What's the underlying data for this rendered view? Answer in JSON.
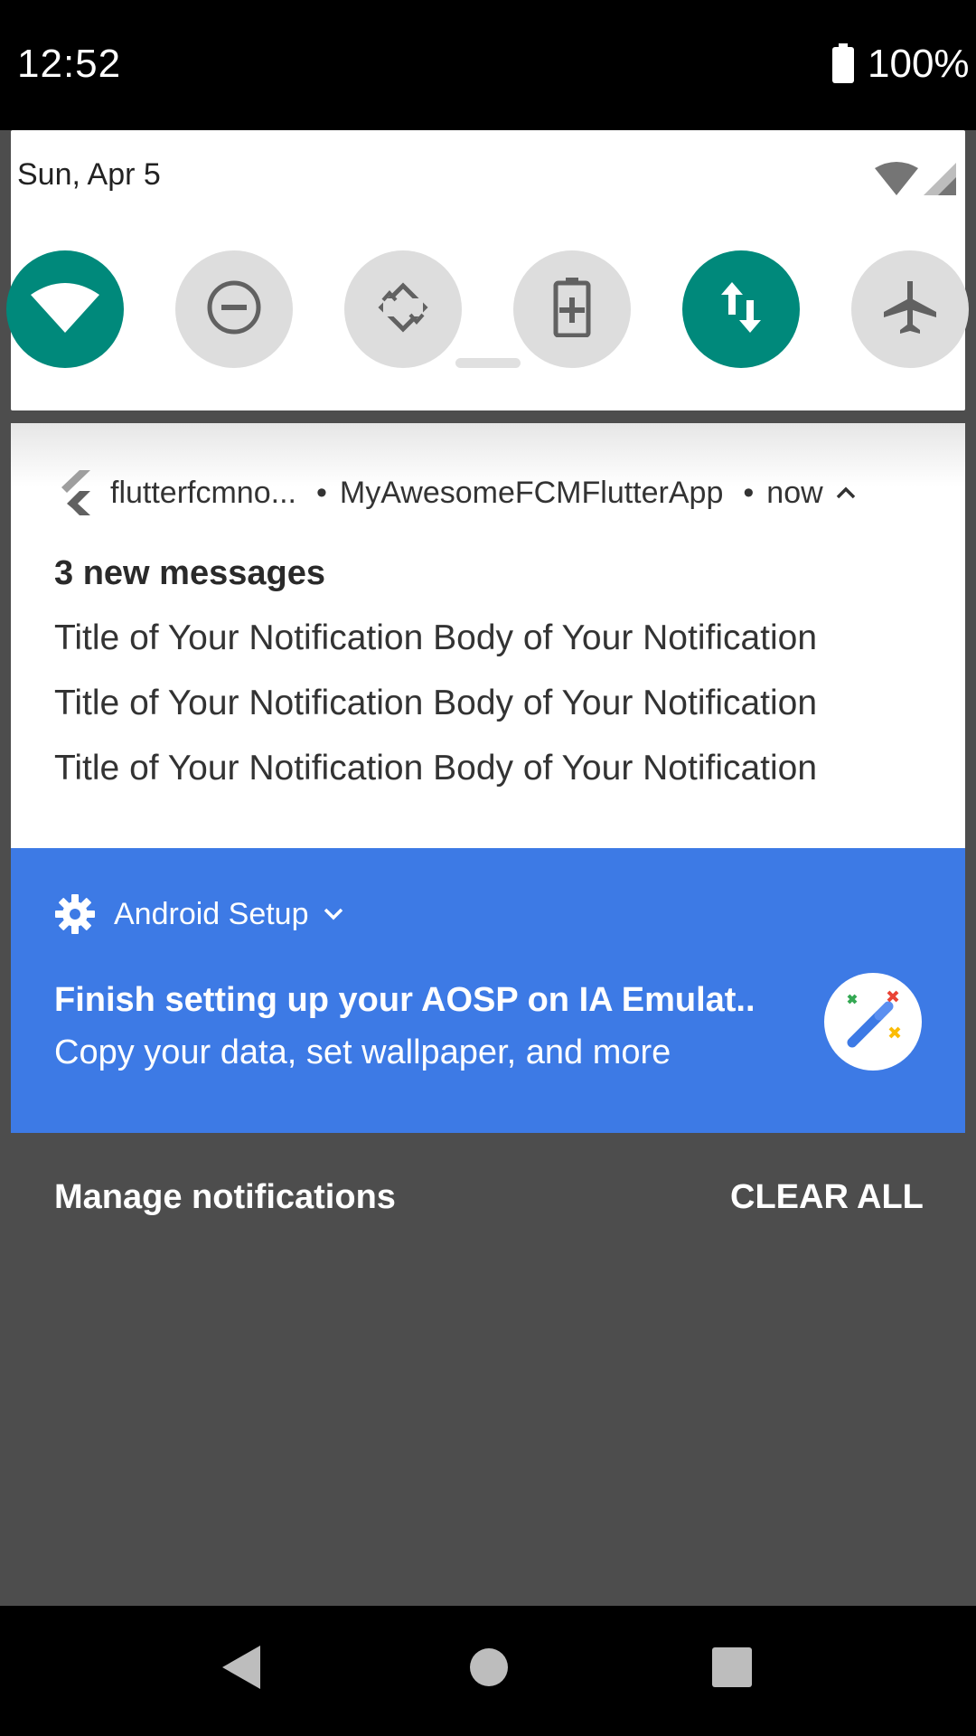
{
  "status_bar": {
    "time": "12:52",
    "battery": "100%"
  },
  "quick_settings": {
    "date": "Sun, Apr 5",
    "accent_color": "#00897b",
    "tiles": [
      {
        "icon": "wifi-icon",
        "state": "on"
      },
      {
        "icon": "do-not-disturb-icon",
        "state": "off"
      },
      {
        "icon": "auto-rotate-icon",
        "state": "off"
      },
      {
        "icon": "battery-saver-icon",
        "state": "off"
      },
      {
        "icon": "mobile-data-icon",
        "state": "on"
      },
      {
        "icon": "airplane-mode-icon",
        "state": "off"
      }
    ]
  },
  "notification": {
    "app_name": "flutterfcmno...",
    "channel": "MyAwesomeFCMFlutterApp",
    "time": "now",
    "title": "3 new messages",
    "lines": [
      "Title of Your Notification Body of Your Notification",
      "Title of Your Notification Body of Your Notification",
      "Title of Your Notification Body of Your Notification"
    ]
  },
  "setup_notification": {
    "app_name": "Android Setup",
    "title": "Finish setting up your AOSP on IA Emulat..",
    "body": "Copy your data, set wallpaper, and more",
    "color": "#3d7ae5"
  },
  "actions": {
    "manage": "Manage notifications",
    "clear_all": "CLEAR ALL"
  },
  "nav": {
    "back": "back-icon",
    "home": "home-icon",
    "recents": "recents-icon"
  }
}
